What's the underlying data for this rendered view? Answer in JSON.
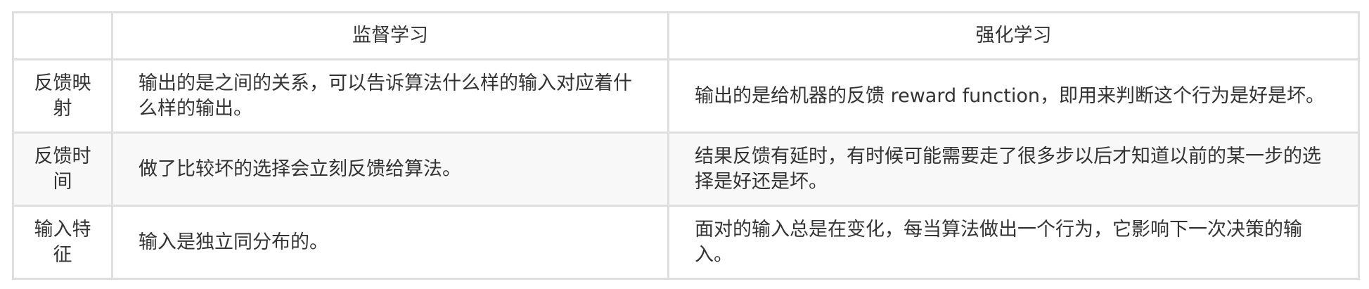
{
  "table": {
    "headers": [
      "",
      "监督学习",
      "强化学习"
    ],
    "rows": [
      {
        "label": "反馈映射",
        "supervised": "输出的是之间的关系，可以告诉算法什么样的输入对应着什么样的输出。",
        "reinforcement": "输出的是给机器的反馈 reward function，即用来判断这个行为是好是坏。"
      },
      {
        "label": "反馈时间",
        "supervised": "做了比较坏的选择会立刻反馈给算法。",
        "reinforcement": "结果反馈有延时，有时候可能需要走了很多步以后才知道以前的某一步的选择是好还是坏。"
      },
      {
        "label": "输入特征",
        "supervised": "输入是独立同分布的。",
        "reinforcement": "面对的输入总是在变化，每当算法做出一个行为，它影响下一次决策的输入。"
      }
    ]
  }
}
